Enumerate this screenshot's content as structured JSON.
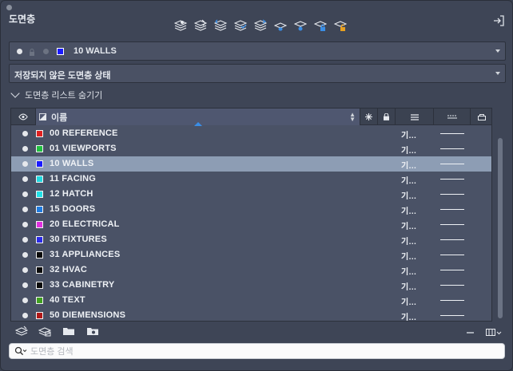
{
  "panel": {
    "title": "도면층"
  },
  "current_layer": {
    "name": "10 WALLS",
    "color": "#1a1aff"
  },
  "state": {
    "label": "저장되지 않은 도면층 상태"
  },
  "list_toggle": {
    "label": "도면층 리스트 숨기기"
  },
  "table": {
    "header": {
      "name_label": "이름"
    },
    "rows": [
      {
        "name": "00 REFERENCE",
        "color": "#e02020",
        "linetype": "기…",
        "selected": false
      },
      {
        "name": "01 VIEWPORTS",
        "color": "#20c040",
        "linetype": "기…",
        "selected": false
      },
      {
        "name": "10 WALLS",
        "color": "#1a1aff",
        "linetype": "기…",
        "selected": true
      },
      {
        "name": "11 FACING",
        "color": "#20d8e0",
        "linetype": "기…",
        "selected": false
      },
      {
        "name": "12 HATCH",
        "color": "#20e0e8",
        "linetype": "기…",
        "selected": false
      },
      {
        "name": "15 DOORS",
        "color": "#1e7be0",
        "linetype": "기…",
        "selected": false
      },
      {
        "name": "20 ELECTRICAL",
        "color": "#e030e0",
        "linetype": "기…",
        "selected": false
      },
      {
        "name": "30 FIXTURES",
        "color": "#2a2ae8",
        "linetype": "기…",
        "selected": false
      },
      {
        "name": "31 APPLIANCES",
        "color": "#0a0a0a",
        "linetype": "기…",
        "selected": false
      },
      {
        "name": "32 HVAC",
        "color": "#0a0a0a",
        "linetype": "기…",
        "selected": false
      },
      {
        "name": "33 CABINETRY",
        "color": "#0a0a0a",
        "linetype": "기…",
        "selected": false
      },
      {
        "name": "40 TEXT",
        "color": "#40a020",
        "linetype": "기…",
        "selected": false
      },
      {
        "name": "50 DIEMENSIONS",
        "color": "#b01818",
        "linetype": "기…",
        "selected": false
      }
    ]
  },
  "search": {
    "placeholder": "도면층 검색",
    "value": ""
  }
}
